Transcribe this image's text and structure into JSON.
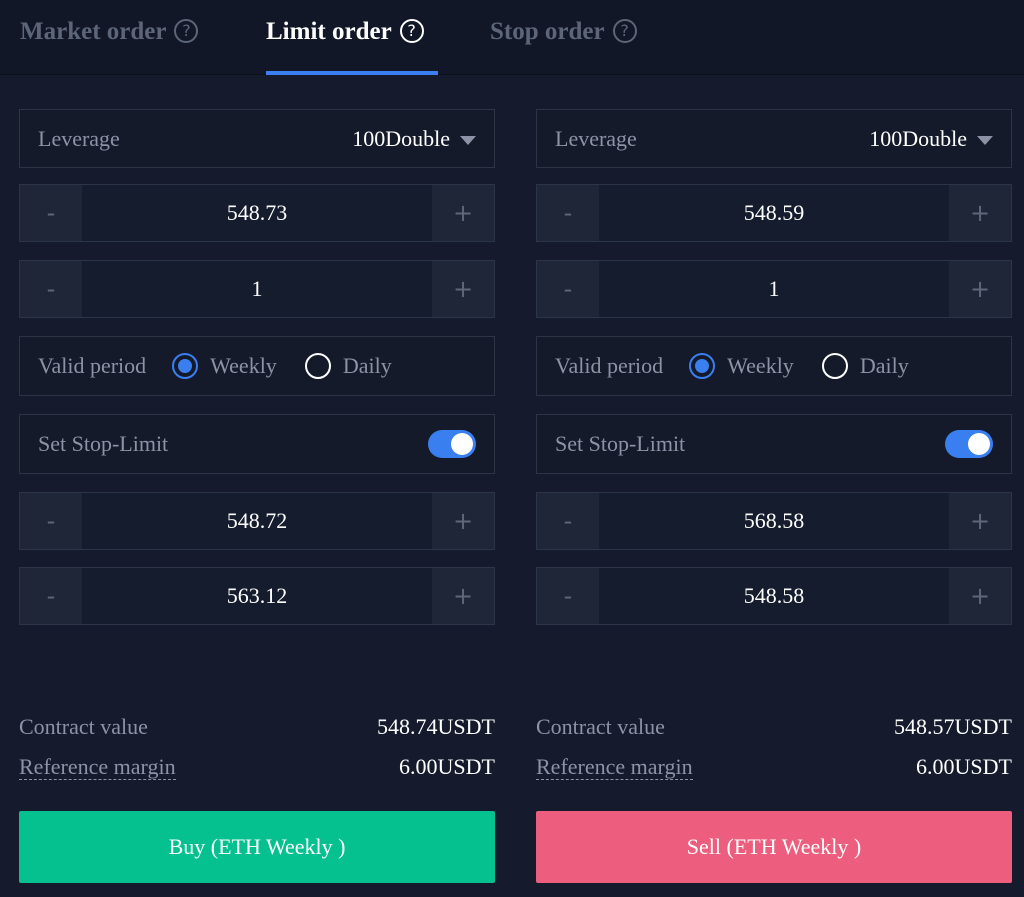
{
  "tabs": [
    {
      "label": "Market order",
      "active": false
    },
    {
      "label": "Limit order",
      "active": true
    },
    {
      "label": "Stop order",
      "active": false
    }
  ],
  "help_glyph": "?",
  "colors": {
    "accent": "#3a7ff0",
    "buy": "#05c08f",
    "sell": "#ed5e7e",
    "background": "#151b2c"
  },
  "stepper": {
    "minus": "-",
    "plus": "+"
  },
  "buy": {
    "leverage_label": "Leverage",
    "leverage_value": "100Double",
    "price": "548.73",
    "quantity": "1",
    "valid_period_label": "Valid period",
    "period_options": {
      "weekly": "Weekly",
      "daily": "Daily"
    },
    "period_selected": "Weekly",
    "stop_limit_label": "Set Stop-Limit",
    "stop_limit_on": true,
    "stop_price_1": "548.72",
    "stop_price_2": "563.12",
    "contract_value_label": "Contract value",
    "contract_value": "548.74USDT",
    "reference_margin_label": "Reference margin",
    "reference_margin": "6.00USDT",
    "action_label": "Buy (ETH Weekly )"
  },
  "sell": {
    "leverage_label": "Leverage",
    "leverage_value": "100Double",
    "price": "548.59",
    "quantity": "1",
    "valid_period_label": "Valid period",
    "period_options": {
      "weekly": "Weekly",
      "daily": "Daily"
    },
    "period_selected": "Weekly",
    "stop_limit_label": "Set Stop-Limit",
    "stop_limit_on": true,
    "stop_price_1": "568.58",
    "stop_price_2": "548.58",
    "contract_value_label": "Contract value",
    "contract_value": "548.57USDT",
    "reference_margin_label": "Reference margin",
    "reference_margin": "6.00USDT",
    "action_label": "Sell (ETH Weekly )"
  }
}
